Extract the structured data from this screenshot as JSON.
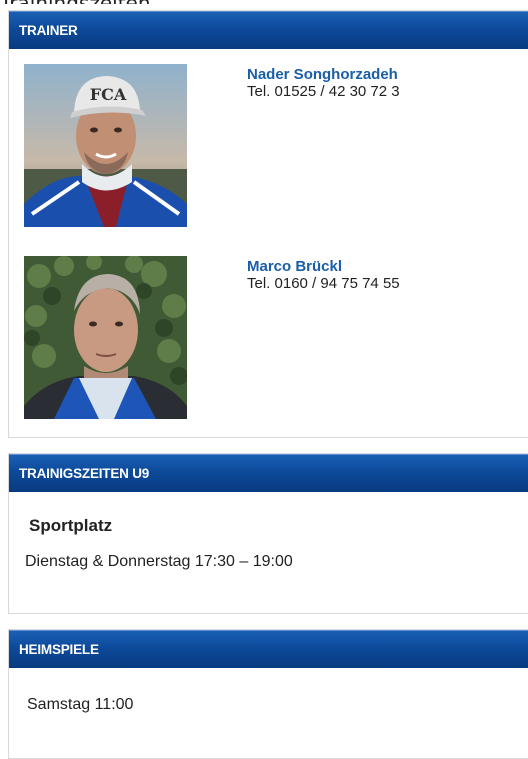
{
  "trainer_box": {
    "header": "TRAINER",
    "trainers": [
      {
        "name": "Nader Songhorzadeh",
        "phone": "Tel. 01525 / 42 30 72 3",
        "photo": "trainer-photo-nader"
      },
      {
        "name": "Marco Brückl",
        "phone": "Tel. 0160 / 94 75 74 55",
        "photo": "trainer-photo-marco"
      }
    ],
    "cap_text": "FCA"
  },
  "times_box": {
    "header": "TRAINIGSZEITEN U9",
    "location": "Sportplatz",
    "schedule": "Dienstag & Donnerstag 17:30 – 19:00"
  },
  "home_box": {
    "header": "HEIMSPIELE",
    "schedule": "Samstag 11:00"
  },
  "colors": {
    "header_bg": "#0d4a9a",
    "name_link": "#1a5ea8"
  }
}
